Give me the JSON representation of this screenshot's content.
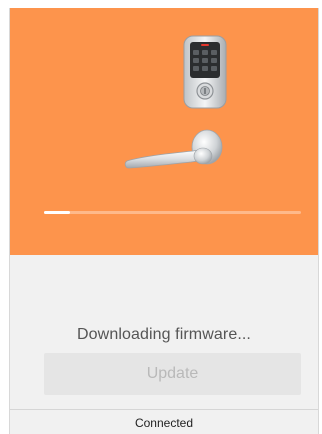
{
  "hero": {
    "background_color": "#fd944c",
    "device_icon": "smart-lock-keypad-icon",
    "handle_icon": "door-lever-handle-icon",
    "download_progress": 0.1
  },
  "status": {
    "message": "Downloading firmware..."
  },
  "actions": {
    "update_label": "Update"
  },
  "footer": {
    "connection_status": "Connected"
  }
}
